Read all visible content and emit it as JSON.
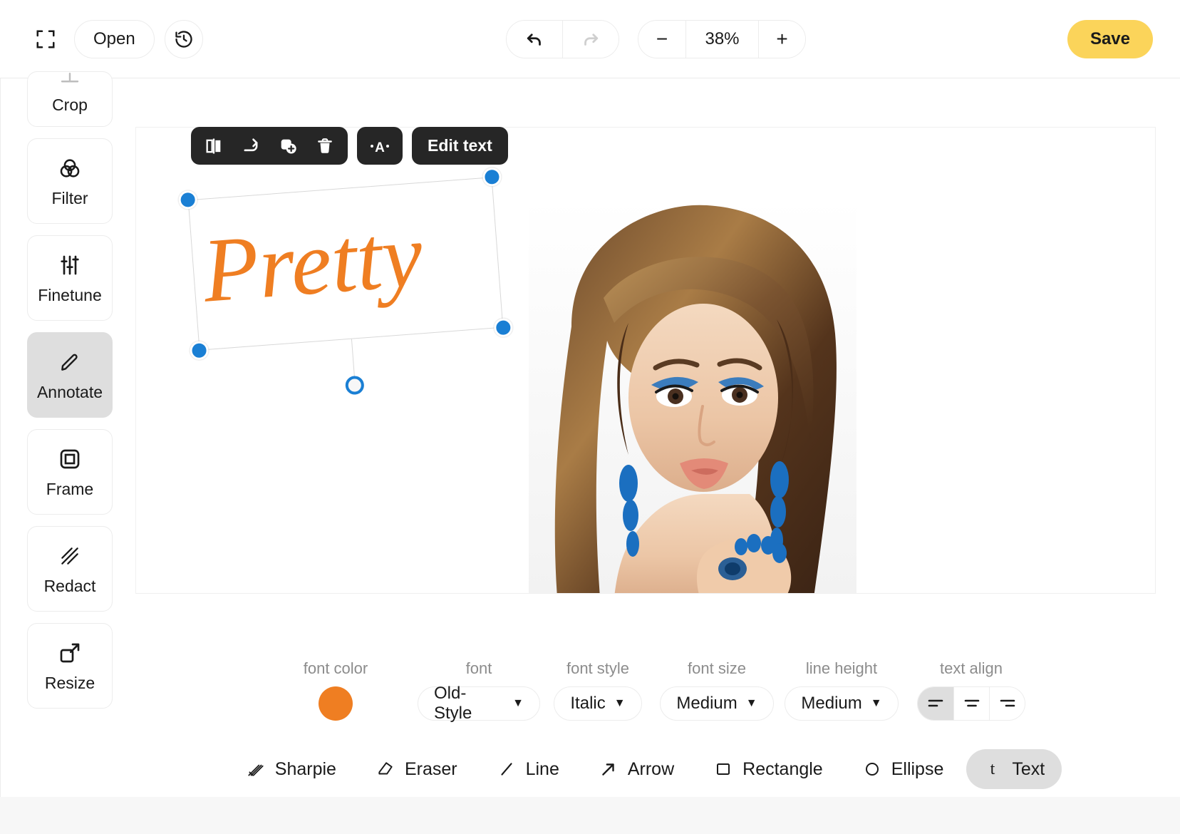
{
  "app": {
    "accent_orange": "#ef7e22",
    "save_yellow": "#fbd45a",
    "handle_blue": "#1a7fd4"
  },
  "topbar": {
    "fullscreen_icon": "fullscreen-icon",
    "open_label": "Open",
    "history_icon": "history-icon",
    "undo_icon": "undo-icon",
    "redo_icon": "redo-icon",
    "zoom_out_label": "−",
    "zoom_level": "38%",
    "zoom_in_label": "+",
    "save_label": "Save"
  },
  "sidebar": {
    "items": [
      {
        "label": "Crop",
        "icon": "crop-icon",
        "active": false
      },
      {
        "label": "Filter",
        "icon": "filter-icon",
        "active": false
      },
      {
        "label": "Finetune",
        "icon": "finetune-icon",
        "active": false
      },
      {
        "label": "Annotate",
        "icon": "pencil-icon",
        "active": true
      },
      {
        "label": "Frame",
        "icon": "frame-icon",
        "active": false
      },
      {
        "label": "Redact",
        "icon": "redact-icon",
        "active": false
      },
      {
        "label": "Resize",
        "icon": "resize-icon",
        "active": false
      }
    ]
  },
  "float_toolbar": {
    "flip_icon": "flip-horizontal-icon",
    "rotate_icon": "rotate-icon",
    "duplicate_icon": "duplicate-icon",
    "delete_icon": "trash-icon",
    "font_icon": "font-letter-a-icon",
    "edit_text_label": "Edit text"
  },
  "canvas": {
    "text_object": {
      "content": "Pretty",
      "color": "#ef7e22",
      "rotation_deg": -4.3
    }
  },
  "options": {
    "font_color": {
      "label": "font color",
      "value": "#ef7e22"
    },
    "font": {
      "label": "font",
      "value": "Old-Style"
    },
    "font_style": {
      "label": "font style",
      "value": "Italic"
    },
    "font_size": {
      "label": "font size",
      "value": "Medium"
    },
    "line_height": {
      "label": "line height",
      "value": "Medium"
    },
    "text_align": {
      "label": "text align",
      "options": [
        {
          "name": "align-left",
          "active": true
        },
        {
          "name": "align-center",
          "active": false
        },
        {
          "name": "align-right",
          "active": false
        }
      ]
    }
  },
  "tools": [
    {
      "label": "Sharpie",
      "icon": "sharpie-icon",
      "active": false
    },
    {
      "label": "Eraser",
      "icon": "eraser-icon",
      "active": false
    },
    {
      "label": "Line",
      "icon": "line-icon",
      "active": false
    },
    {
      "label": "Arrow",
      "icon": "arrow-icon",
      "active": false
    },
    {
      "label": "Rectangle",
      "icon": "rectangle-icon",
      "active": false
    },
    {
      "label": "Ellipse",
      "icon": "ellipse-icon",
      "active": false
    },
    {
      "label": "Text",
      "icon": "text-t-icon",
      "active": true
    }
  ]
}
